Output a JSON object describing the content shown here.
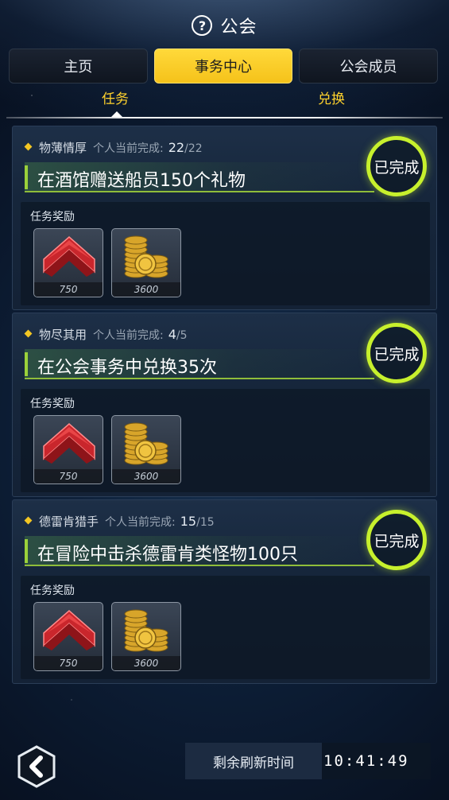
{
  "header": {
    "title": "公会",
    "help_icon": "?"
  },
  "tabs": [
    {
      "label": "主页",
      "active": false
    },
    {
      "label": "事务中心",
      "active": true
    },
    {
      "label": "公会成员",
      "active": false
    }
  ],
  "subtabs": [
    {
      "label": "任务",
      "active": true
    },
    {
      "label": "兑换",
      "active": false
    }
  ],
  "quests": [
    {
      "name": "物薄情厚",
      "progress_label": "个人当前完成:",
      "progress_current": "22",
      "progress_sep": "/",
      "progress_max": "22",
      "description": "在酒馆赠送船员150个礼物",
      "status": "已完成",
      "reward_label": "任务奖励",
      "rewards": [
        {
          "icon": "red-chevron-icon",
          "count": "750"
        },
        {
          "icon": "gold-coins-icon",
          "count": "3600"
        }
      ]
    },
    {
      "name": "物尽其用",
      "progress_label": "个人当前完成:",
      "progress_current": "4",
      "progress_sep": "/",
      "progress_max": "5",
      "description": "在公会事务中兑换35次",
      "status": "已完成",
      "reward_label": "任务奖励",
      "rewards": [
        {
          "icon": "red-chevron-icon",
          "count": "750"
        },
        {
          "icon": "gold-coins-icon",
          "count": "3600"
        }
      ]
    },
    {
      "name": "德雷肯猎手",
      "progress_label": "个人当前完成:",
      "progress_current": "15",
      "progress_sep": "/",
      "progress_max": "15",
      "description": "在冒险中击杀德雷肯类怪物100只",
      "status": "已完成",
      "reward_label": "任务奖励",
      "rewards": [
        {
          "icon": "red-chevron-icon",
          "count": "750"
        },
        {
          "icon": "gold-coins-icon",
          "count": "3600"
        }
      ]
    }
  ],
  "footer": {
    "refresh_label": "剩余刷新时间",
    "refresh_time": "10:41:49",
    "back_icon": "back-chevron-icon"
  },
  "colors": {
    "accent": "#ffd22d",
    "done_ring": "#c7f02d",
    "desc_border": "#8fbd3a"
  }
}
